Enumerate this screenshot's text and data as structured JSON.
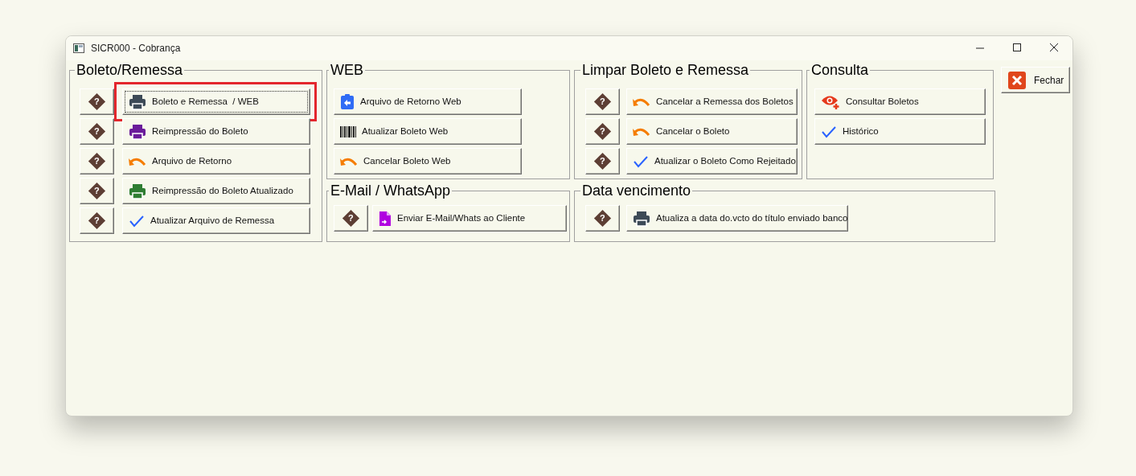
{
  "window": {
    "title": "SICR000 - Cobrança"
  },
  "groups": [
    {
      "title": "Boleto/Remessa",
      "buttons": [
        {
          "label": "Boleto e Remessa  / WEB",
          "kind": "print",
          "color": "#3d4a57",
          "help": "?",
          "focused": true
        },
        {
          "label": "Reimpressão do Boleto",
          "kind": "print",
          "color": "#6a1b9a",
          "help": "?",
          "focused": false
        },
        {
          "label": "Arquivo de Retorno",
          "kind": "undo",
          "help": "?",
          "focused": false
        },
        {
          "label": "Reimpressão do Boleto Atualizado",
          "kind": "print",
          "color": "#2e7d32",
          "help": "?",
          "focused": false
        },
        {
          "label": "Atualizar Arquivo de Remessa",
          "kind": "check",
          "help": "?",
          "focused": false
        }
      ]
    },
    {
      "title": "WEB",
      "buttons": [
        {
          "label": "Arquivo de Retorno Web",
          "kind": "import",
          "focused": false
        },
        {
          "label": "Atualizar Boleto Web",
          "kind": "barcode",
          "focused": false
        },
        {
          "label": "Cancelar Boleto Web",
          "kind": "undo",
          "focused": false
        }
      ]
    },
    {
      "title": "Limpar Boleto e Remessa",
      "buttons": [
        {
          "label": "Cancelar a Remessa dos Boletos",
          "kind": "undo",
          "help": "?",
          "focused": false
        },
        {
          "label": "Cancelar o Boleto",
          "kind": "undo",
          "help": "?",
          "focused": false
        },
        {
          "label": "Atualizar o Boleto Como Rejeitado",
          "kind": "check",
          "help": "?",
          "focused": false
        }
      ]
    },
    {
      "title": "Consulta",
      "buttons": [
        {
          "label": "Consultar Boletos",
          "kind": "view",
          "focused": false
        },
        {
          "label": "Histórico",
          "kind": "check",
          "focused": false
        }
      ]
    },
    {
      "title": "E-Mail / WhatsApp",
      "buttons": [
        {
          "label": "Enviar E-Mail/Whats ao Cliente",
          "kind": "send",
          "help": "?",
          "focused": false
        }
      ]
    },
    {
      "title": "Data vencimento",
      "buttons": [
        {
          "label": "Atualiza a data do.vcto do título enviado banco",
          "kind": "print",
          "color": "#3d4a57",
          "help": "?",
          "focused": false
        }
      ]
    }
  ],
  "close_button": {
    "label": "Fechar"
  }
}
